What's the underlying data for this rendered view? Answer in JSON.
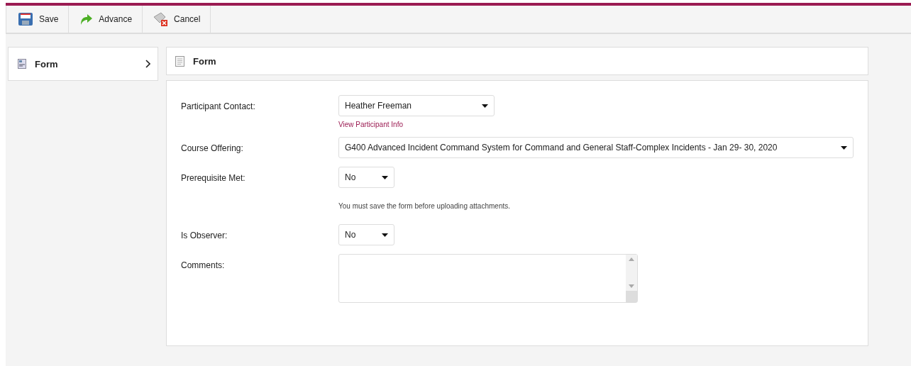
{
  "toolbar": {
    "buttons": [
      {
        "label": "Save",
        "kind": "save"
      },
      {
        "label": "Advance",
        "kind": "advance"
      },
      {
        "label": "Cancel",
        "kind": "cancel"
      }
    ]
  },
  "sidebar": {
    "items": [
      {
        "label": "Form"
      }
    ]
  },
  "panel": {
    "title": "Form",
    "rows": [
      {
        "label": "Participant Contact:",
        "field": {
          "kind": "dropdown",
          "value": "Heather Freeman"
        },
        "link": "View Participant Info"
      },
      {
        "label": "Course Offering:",
        "field": {
          "kind": "fullwidth",
          "value": "G400 Advanced Incident Command System for Command and General Staff-Complex Incidents - Jan 29- 30, 2020"
        }
      },
      {
        "label": "Prerequisite Met:",
        "field": {
          "kind": "compact",
          "value": "No"
        },
        "note": "You must save the form before uploading attachments."
      },
      {
        "label": "Is Observer:",
        "field": {
          "kind": "compact",
          "value": "No"
        }
      },
      {
        "label": "Comments:",
        "field": {
          "kind": "textarea"
        }
      }
    ]
  }
}
